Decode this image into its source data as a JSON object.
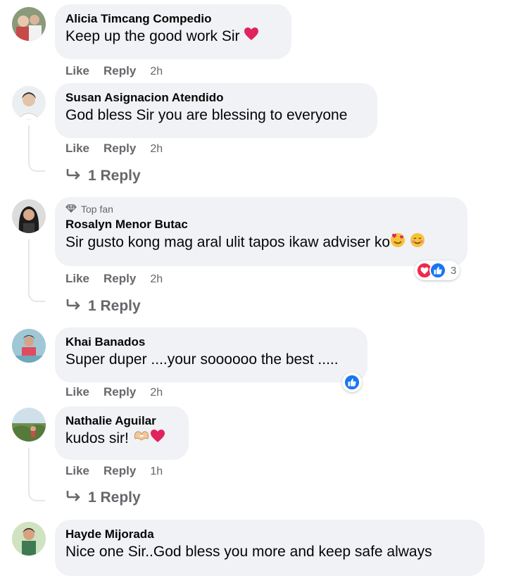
{
  "colors": {
    "bubble": "#f0f2f5",
    "meta": "#65676b",
    "like_blue": "#1877f2",
    "love_red": "#f02849"
  },
  "comments": [
    {
      "name": "Alicia Timcang Compedio",
      "text": "Keep up the good work Sir",
      "emoji": [
        "heart-emoji"
      ],
      "like": "Like",
      "reply": "Reply",
      "time": "2h"
    },
    {
      "name": "Susan Asignacion Atendido",
      "text": "God bless Sir you are blessing to everyone",
      "like": "Like",
      "reply": "Reply",
      "time": "2h",
      "replies": "1 Reply"
    },
    {
      "badge": "Top fan",
      "name": "Rosalyn Menor Butac",
      "text": "Sir gusto kong mag aral ulit tapos ikaw adviser ko",
      "emoji": [
        "smiling-face-with-hearts-emoji",
        "blushing-face-emoji"
      ],
      "reactions": {
        "icons": [
          "love-reaction-icon",
          "like-reaction-icon"
        ],
        "count": "3"
      },
      "like": "Like",
      "reply": "Reply",
      "time": "2h",
      "replies": "1 Reply"
    },
    {
      "name": "Khai Banados",
      "text": "Super duper ....your soooooo the best .....",
      "reactions": {
        "icons": [
          "like-reaction-icon"
        ]
      },
      "like": "Like",
      "reply": "Reply",
      "time": "2h"
    },
    {
      "name": "Nathalie Aguilar",
      "text": "kudos sir!",
      "emoji": [
        "heart-hands-emoji",
        "heart-emoji"
      ],
      "like": "Like",
      "reply": "Reply",
      "time": "1h",
      "replies": "1 Reply"
    },
    {
      "name": "Hayde Mijorada",
      "text": "Nice one Sir..God bless you more and keep safe always"
    }
  ]
}
